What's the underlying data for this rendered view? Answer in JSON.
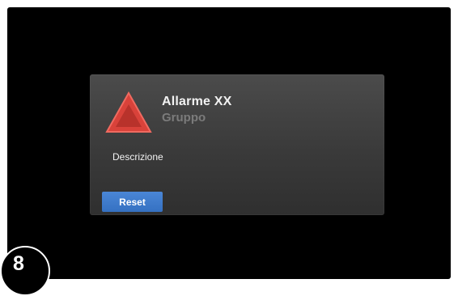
{
  "alarm": {
    "title": "Allarme XX",
    "group": "Gruppo",
    "description": "Descrizione",
    "icon": "warning-triangle-icon",
    "icon_color": "#d9423a"
  },
  "actions": {
    "reset_label": "Reset"
  },
  "step": {
    "number": "8"
  },
  "colors": {
    "screen_background": "#000000",
    "dialog_background": "#3d3d3d",
    "button_background": "#3f7ccc",
    "title_text": "#f2f2f2",
    "group_text": "#7b7b7b"
  }
}
